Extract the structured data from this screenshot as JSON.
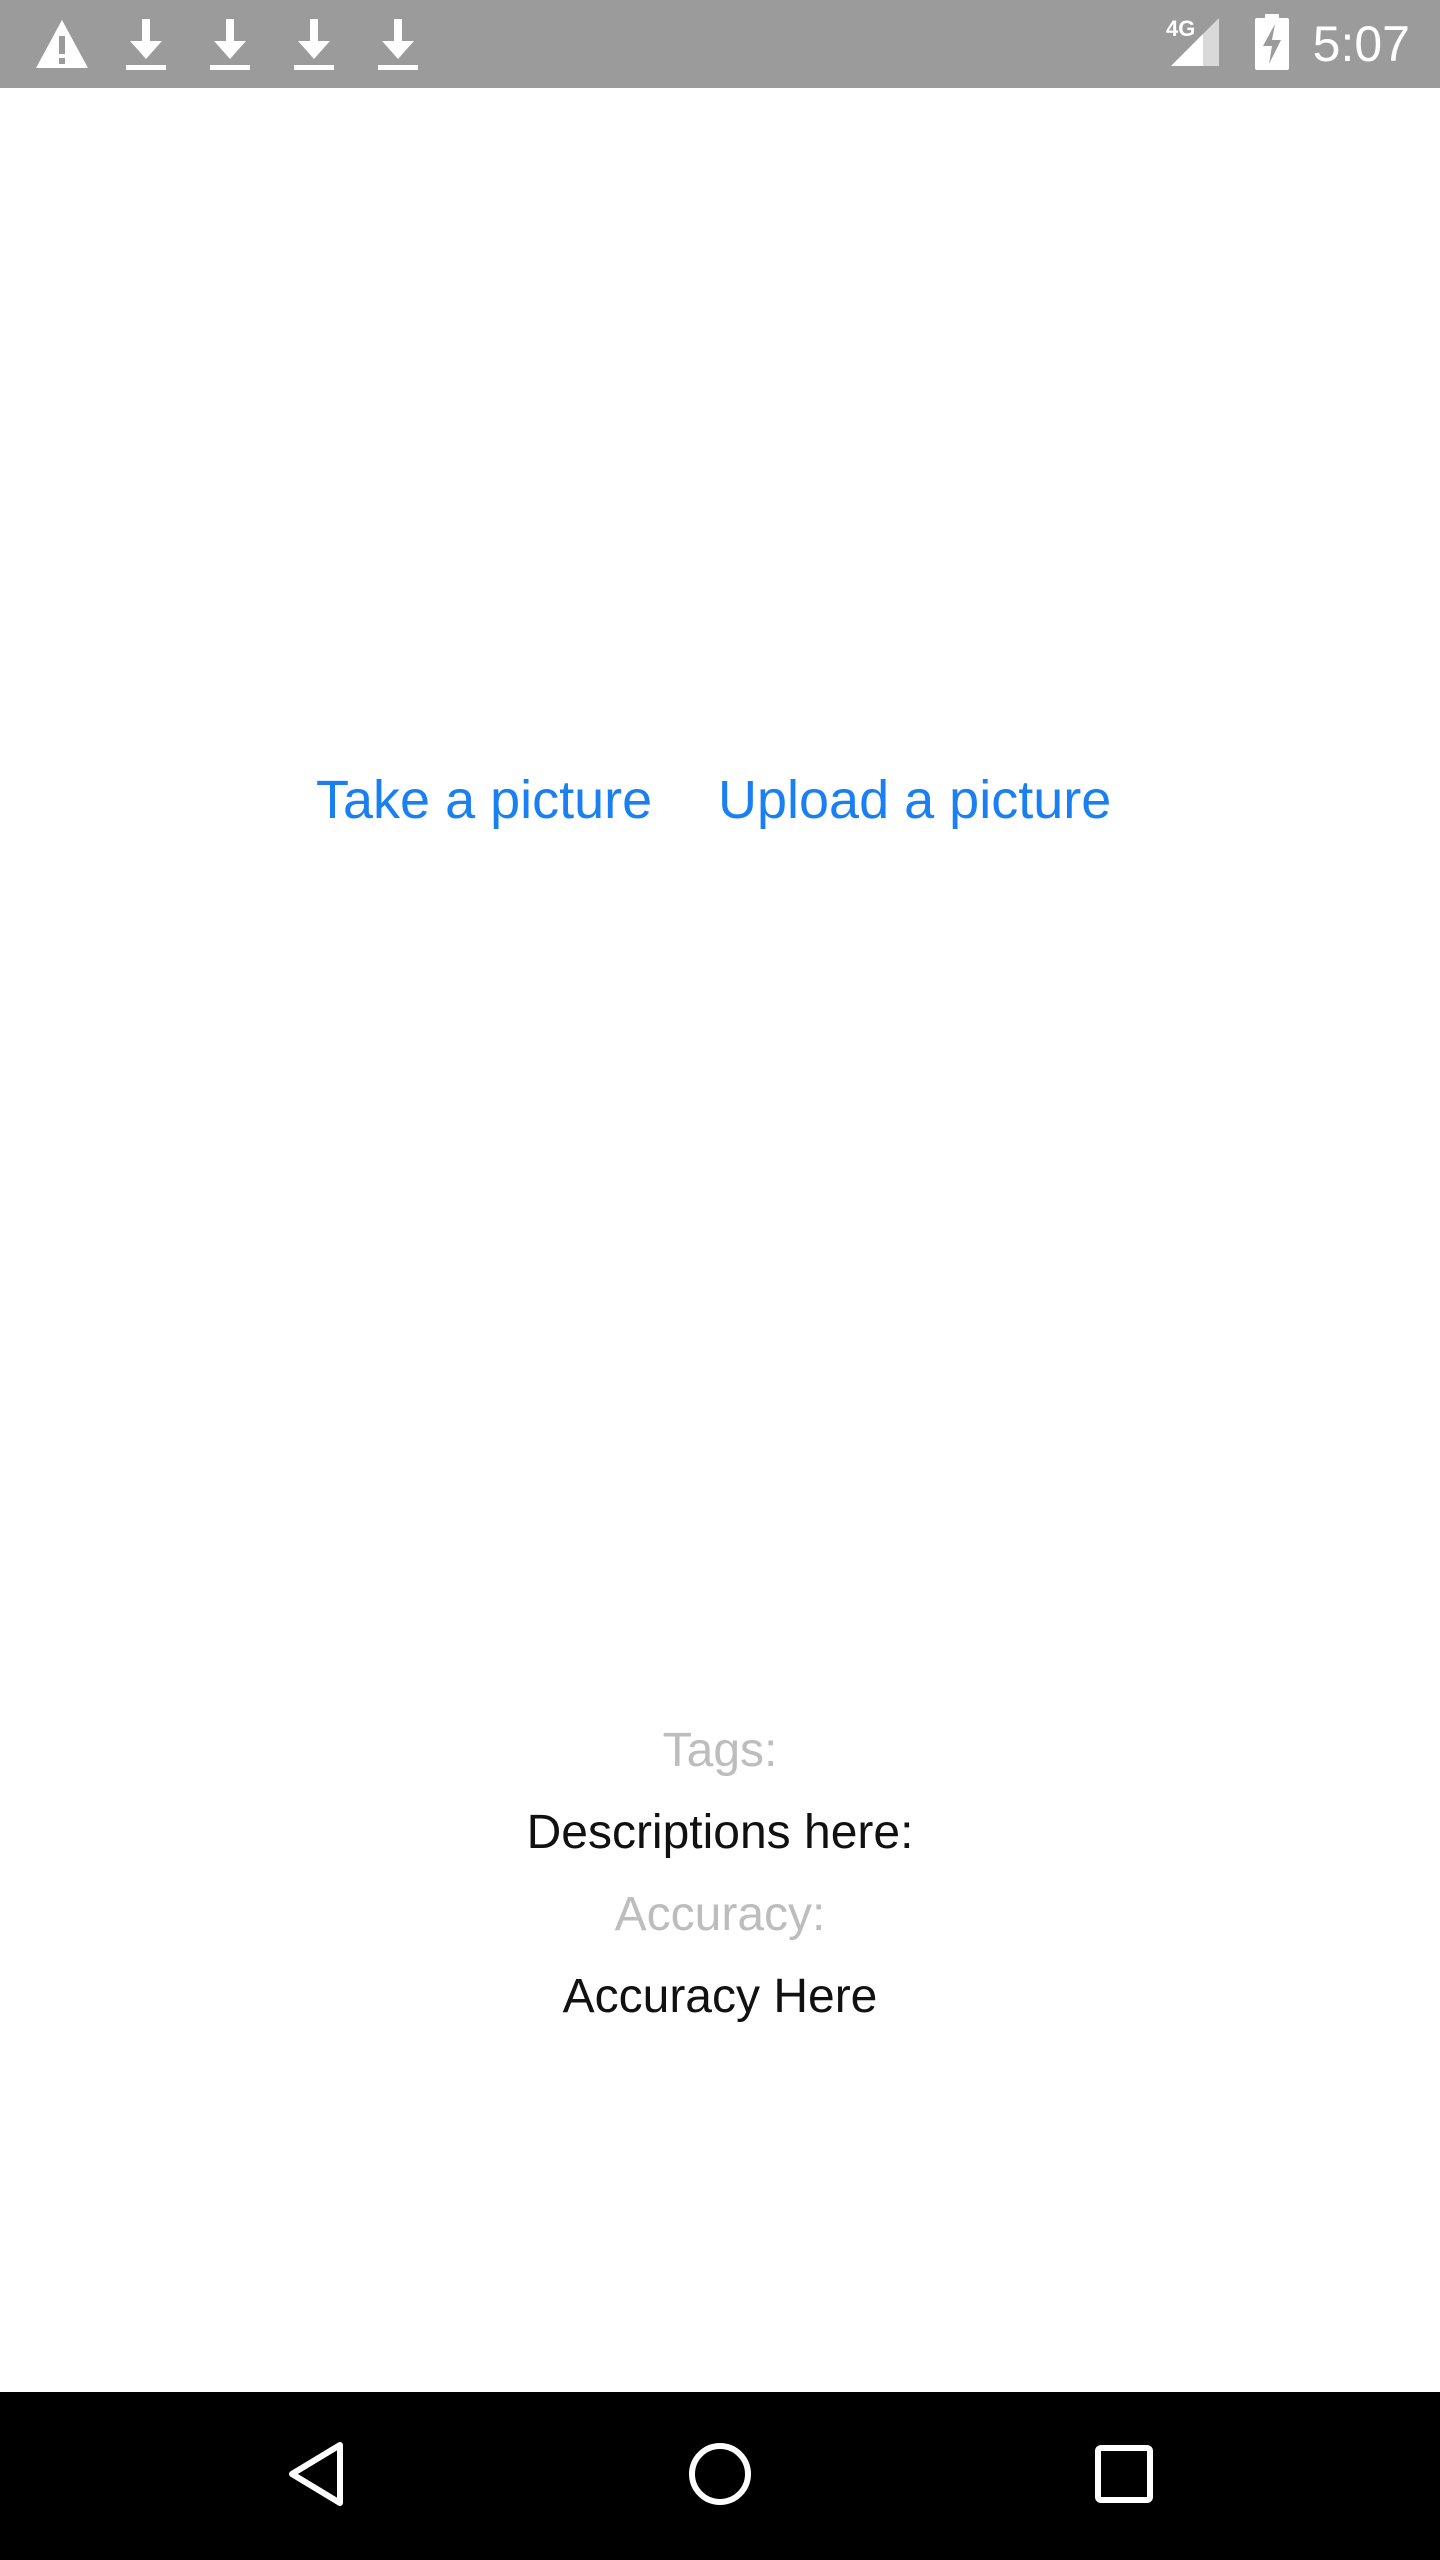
{
  "status_bar": {
    "left_icons": [
      "warning-icon",
      "download-icon",
      "download-icon",
      "download-icon",
      "download-icon"
    ],
    "network_label": "4G",
    "signal_icon": "cell-signal-icon",
    "battery_icon": "battery-charging-icon",
    "time": "5:07",
    "background_color": "#9b9b9b"
  },
  "actions": {
    "take_picture_label": "Take a picture",
    "upload_picture_label": "Upload a picture",
    "link_color": "#1a7ff0"
  },
  "results": {
    "tags_label": "Tags:",
    "descriptions_value": "Descriptions here:",
    "accuracy_label": "Accuracy:",
    "accuracy_value": "Accuracy Here"
  },
  "nav_bar": {
    "back_icon": "back-triangle-icon",
    "home_icon": "home-circle-icon",
    "recents_icon": "recents-square-icon"
  }
}
